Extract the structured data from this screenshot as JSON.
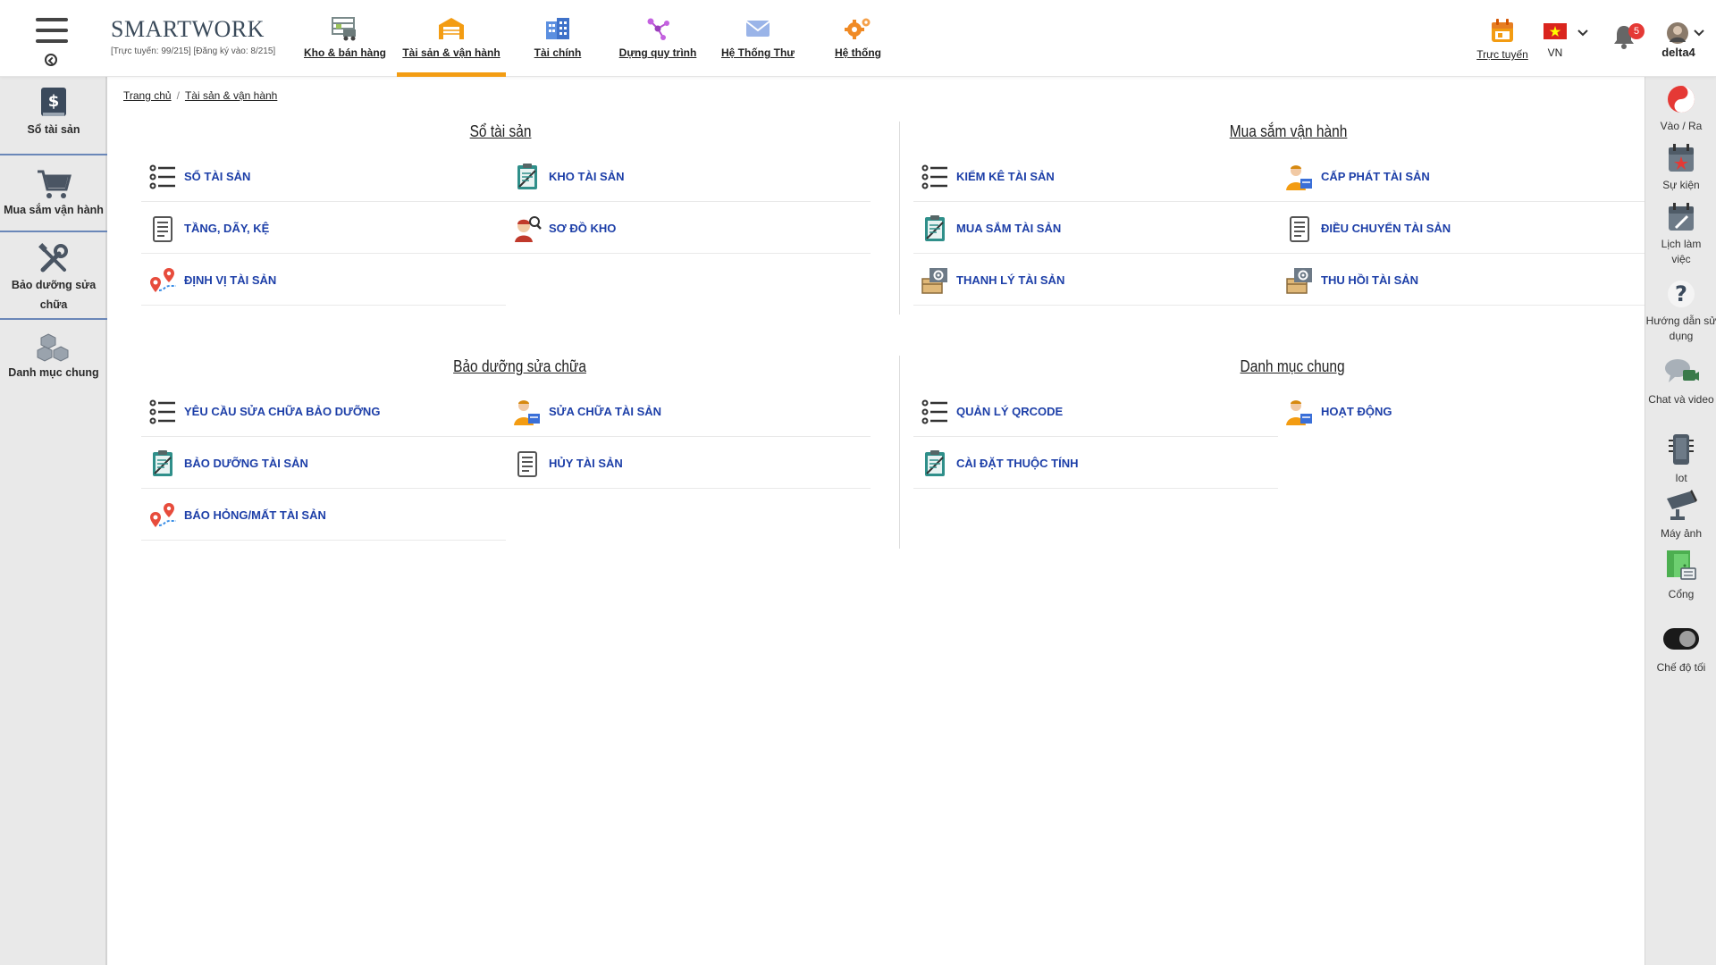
{
  "app": {
    "brand": "SMARTWORK",
    "stats": "[Trực tuyến: 99/215] [Đăng ký vào: 8/215]"
  },
  "modules": [
    {
      "label": "Kho & bán hàng",
      "icon": "warehouse-truck-icon"
    },
    {
      "label": "Tài sản & vận hành",
      "icon": "garage-icon",
      "active": true
    },
    {
      "label": "Tài chính",
      "icon": "buildings-icon"
    },
    {
      "label": "Dựng quy trình",
      "icon": "workflow-icon"
    },
    {
      "label": "Hệ Thống Thư",
      "icon": "mail-icon"
    },
    {
      "label": "Hệ thống",
      "icon": "gears-icon"
    }
  ],
  "topright": {
    "online_label": "Trực tuyến",
    "lang": "VN",
    "notification_count": "5",
    "username": "delta4"
  },
  "sidebar": {
    "items": [
      {
        "label": "Sổ tài sản",
        "icon": "dollar-book-icon"
      },
      {
        "label": "Mua sắm vận hành",
        "icon": "cart-icon"
      },
      {
        "label": "Bảo dưỡng sửa chữa",
        "icon": "tools-icon"
      },
      {
        "label": "Danh mục chung",
        "icon": "boxes-icon"
      }
    ]
  },
  "breadcrumb": {
    "home": "Trang chủ",
    "current": "Tài sản & vận hành"
  },
  "sections": {
    "so_tai_san": {
      "title": "Sổ tài sản",
      "links": [
        "SỔ TÀI SẢN",
        "KHO TÀI SẢN",
        "TẦNG, DÃY, KỆ",
        "SƠ ĐỒ KHO",
        "ĐỊNH VỊ TÀI SẢN"
      ]
    },
    "mua_sam": {
      "title": "Mua sắm vận hành",
      "links": [
        "KIỂM KÊ TÀI SẢN",
        "CẤP PHÁT TÀI SẢN",
        "MUA SẮM TÀI SẢN",
        "ĐIỀU CHUYỂN TÀI SẢN",
        "THANH LÝ TÀI SẢN",
        "THU HỒI TÀI SẢN"
      ]
    },
    "bao_duong": {
      "title": "Bảo dưỡng sửa chữa",
      "links": [
        "YÊU CẦU SỬA CHỮA BẢO DƯỠNG",
        "SỬA CHỮA TÀI SẢN",
        "BẢO DƯỠNG TÀI SẢN",
        "HỦY TÀI SẢN",
        "BÁO HỎNG/MẤT TÀI SẢN"
      ]
    },
    "danh_muc": {
      "title": "Danh mục chung",
      "links": [
        "QUẢN LÝ QRCODE",
        "HOẠT ĐỘNG",
        "CÀI ĐẶT THUỘC TÍNH"
      ]
    }
  },
  "right_sidebar": {
    "items": [
      {
        "label": "Vào / Ra",
        "icon": "yin-yang-icon"
      },
      {
        "label": "Sự kiện",
        "icon": "calendar-star-icon"
      },
      {
        "label": "Lịch làm việc",
        "icon": "calendar-edit-icon"
      },
      {
        "label": "Hướng dẫn sử dụng",
        "icon": "question-icon"
      },
      {
        "label": "Chat và video",
        "icon": "chat-video-icon"
      },
      {
        "label": "Iot",
        "icon": "iot-device-icon"
      },
      {
        "label": "Máy ảnh",
        "icon": "camera-icon"
      },
      {
        "label": "Cổng",
        "icon": "gate-icon"
      },
      {
        "label": "Chế độ tối",
        "icon": "dark-mode-toggle-icon"
      }
    ]
  },
  "colors": {
    "link": "#1d3fa8",
    "active_tab": "#f39c12",
    "sidebar_bg": "#e9e9e9",
    "badge": "#e53935"
  }
}
